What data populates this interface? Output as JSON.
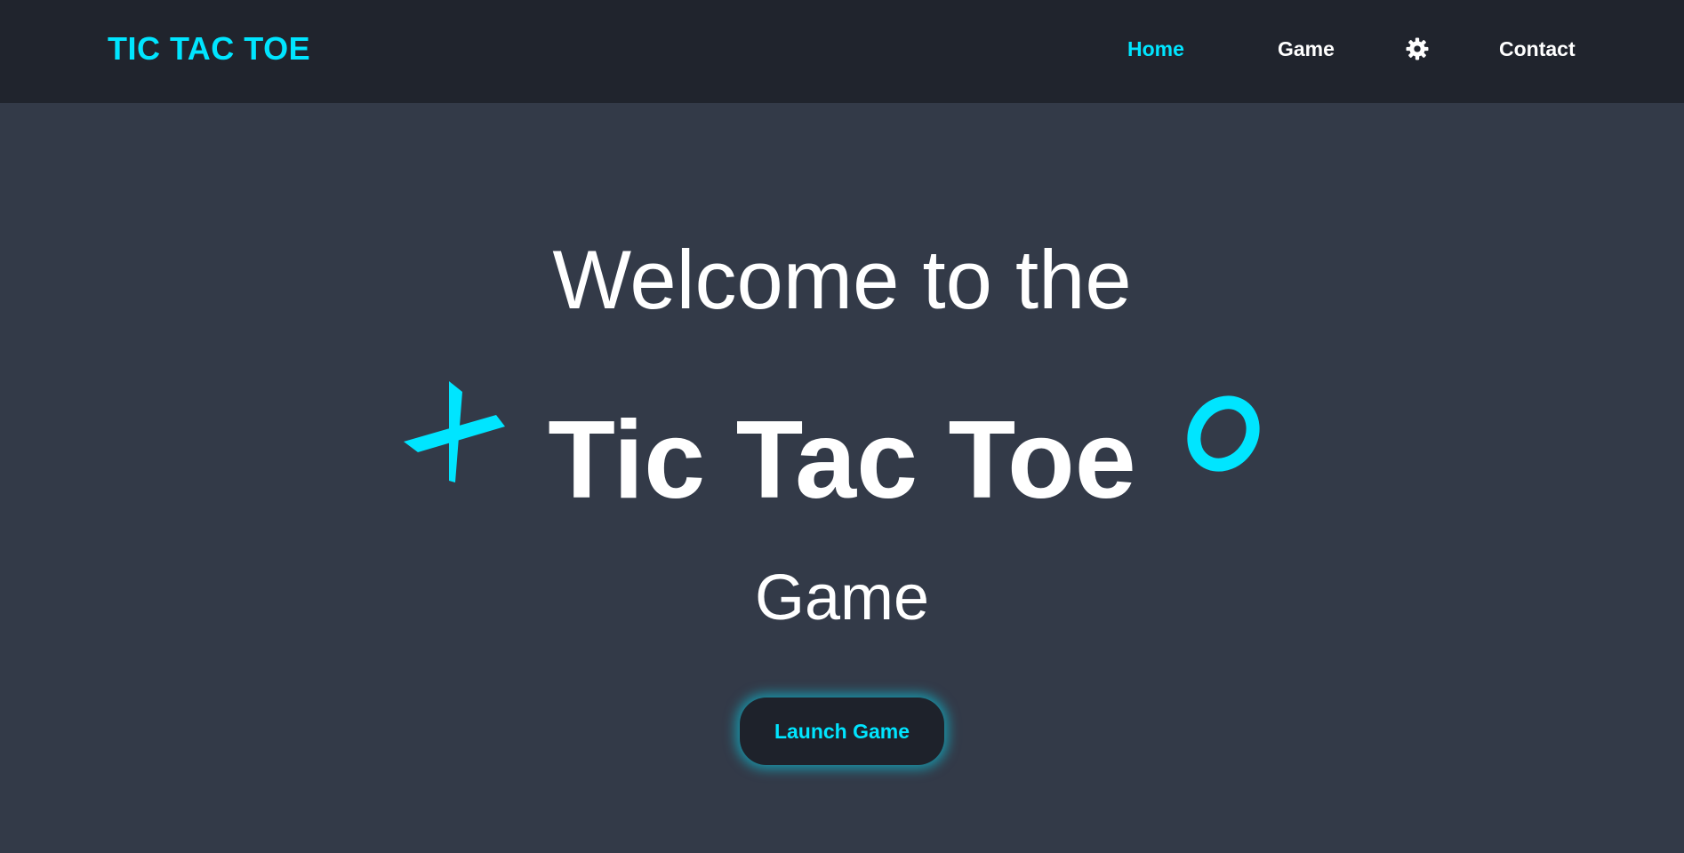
{
  "navbar": {
    "brand": "TIC TAC TOE",
    "links": {
      "home": "Home",
      "game": "Game",
      "contact": "Contact"
    },
    "settings_icon": "gear-icon"
  },
  "hero": {
    "line1": "Welcome to the",
    "title": "Tic Tac Toe",
    "line3": "Game",
    "x_icon": "x-mark-icon",
    "o_icon": "o-mark-icon",
    "launch_button": "Launch Game"
  },
  "colors": {
    "accent": "#00e5ff",
    "navbar_bg": "#20242d",
    "page_bg": "#333a48",
    "text": "#ffffff"
  }
}
